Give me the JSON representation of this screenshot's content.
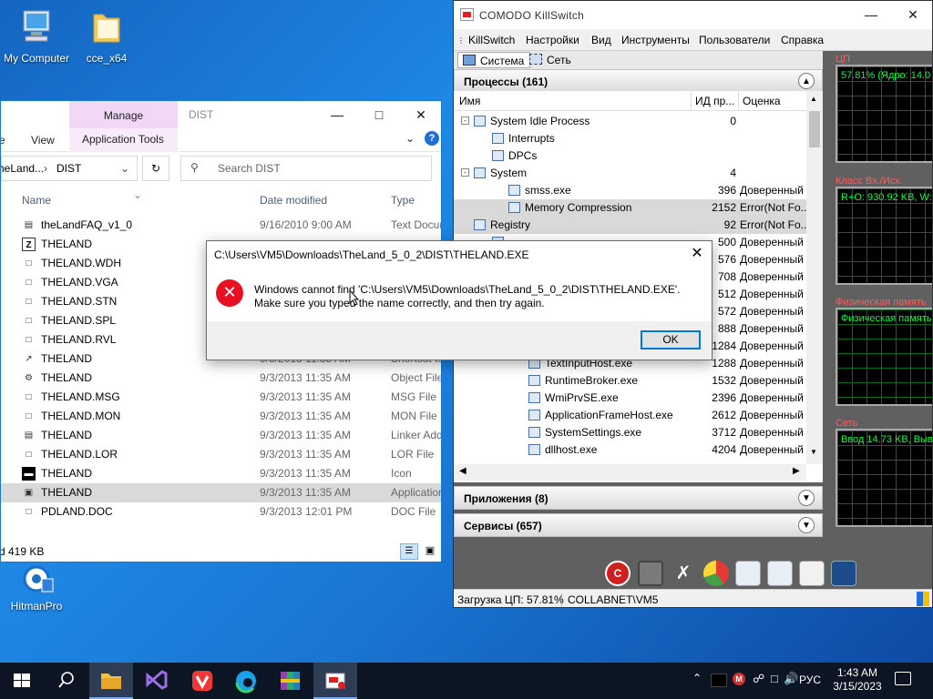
{
  "desktop": {
    "icons": [
      {
        "label": "My Computer"
      },
      {
        "label": "cce_x64"
      },
      {
        "label": "HitmanPro"
      }
    ]
  },
  "explorer": {
    "manage_tab": "Manage",
    "title": "DIST",
    "ribbon": {
      "view": "View",
      "app_tools": "Application Tools",
      "left_item": "e"
    },
    "address": {
      "parent": "heLand...",
      "current": "DIST"
    },
    "search_placeholder": "Search DIST",
    "columns": {
      "name": "Name",
      "date": "Date modified",
      "type": "Type"
    },
    "files": [
      {
        "name": "theLandFAQ_v1_0",
        "date": "9/16/2010 9:00 AM",
        "type": "Text Docum",
        "icon": "text-file-icon"
      },
      {
        "name": "THELAND",
        "date": "",
        "type": "",
        "icon": "z-app-icon"
      },
      {
        "name": "THELAND.WDH",
        "date": "",
        "type": "",
        "icon": "file-icon"
      },
      {
        "name": "THELAND.VGA",
        "date": "",
        "type": "",
        "icon": "file-icon"
      },
      {
        "name": "THELAND.STN",
        "date": "",
        "type": "",
        "icon": "file-icon"
      },
      {
        "name": "THELAND.SPL",
        "date": "",
        "type": "",
        "icon": "file-icon"
      },
      {
        "name": "THELAND.RVL",
        "date": "",
        "type": "",
        "icon": "file-icon"
      },
      {
        "name": "THELAND",
        "date": "9/3/2013 11:35 AM",
        "type": "Shortcut to",
        "icon": "shortcut-icon"
      },
      {
        "name": "THELAND",
        "date": "9/3/2013 11:35 AM",
        "type": "Object File",
        "icon": "object-file-icon"
      },
      {
        "name": "THELAND.MSG",
        "date": "9/3/2013 11:35 AM",
        "type": "MSG File",
        "icon": "file-icon"
      },
      {
        "name": "THELAND.MON",
        "date": "9/3/2013 11:35 AM",
        "type": "MON File",
        "icon": "file-icon"
      },
      {
        "name": "THELAND",
        "date": "9/3/2013 11:35 AM",
        "type": "Linker Addr",
        "icon": "linker-file-icon"
      },
      {
        "name": "THELAND.LOR",
        "date": "9/3/2013 11:35 AM",
        "type": "LOR File",
        "icon": "file-icon"
      },
      {
        "name": "THELAND",
        "date": "9/3/2013 11:35 AM",
        "type": "Icon",
        "icon": "icon-file-icon"
      },
      {
        "name": "THELAND",
        "date": "9/3/2013 11:35 AM",
        "type": "Application",
        "icon": "application-icon"
      },
      {
        "name": "PDLAND.DOC",
        "date": "9/3/2013 12:01 PM",
        "type": "DOC File",
        "icon": "file-icon"
      }
    ],
    "status": "d  419 KB"
  },
  "killswitch": {
    "title": "COMODO KillSwitch",
    "menu": [
      "KillSwitch",
      "Настройки",
      "Вид",
      "Инструменты",
      "Пользователи",
      "Справка"
    ],
    "tabs": [
      "Система",
      "Сеть"
    ],
    "processes_header": "Процессы (161)",
    "columns": {
      "name": "Имя",
      "pid": "ИД пр...",
      "rating": "Оценка"
    },
    "processes": [
      {
        "name": "System Idle Process",
        "pid": "0",
        "rating": ""
      },
      {
        "name": "Interrupts",
        "pid": "",
        "rating": ""
      },
      {
        "name": "DPCs",
        "pid": "",
        "rating": ""
      },
      {
        "name": "System",
        "pid": "4",
        "rating": ""
      },
      {
        "name": "smss.exe",
        "pid": "396",
        "rating": "Доверенный"
      },
      {
        "name": "Memory Compression",
        "pid": "2152",
        "rating": "Error(Not Fo..."
      },
      {
        "name": "Registry",
        "pid": "92",
        "rating": "Error(Not Fo..."
      },
      {
        "name": "",
        "pid": "500",
        "rating": "Доверенный"
      },
      {
        "name": "",
        "pid": "576",
        "rating": "Доверенный"
      },
      {
        "name": "",
        "pid": "708",
        "rating": "Доверенный"
      },
      {
        "name": "",
        "pid": "512",
        "rating": "Доверенный"
      },
      {
        "name": "",
        "pid": "572",
        "rating": "Доверенный"
      },
      {
        "name": "",
        "pid": "888",
        "rating": "Доверенный"
      },
      {
        "name": "",
        "pid": "1284",
        "rating": "Доверенный"
      },
      {
        "name": "TextInputHost.exe",
        "pid": "1288",
        "rating": "Доверенный"
      },
      {
        "name": "RuntimeBroker.exe",
        "pid": "1532",
        "rating": "Доверенный"
      },
      {
        "name": "WmiPrvSE.exe",
        "pid": "2396",
        "rating": "Доверенный"
      },
      {
        "name": "ApplicationFrameHost.exe",
        "pid": "2612",
        "rating": "Доверенный"
      },
      {
        "name": "SystemSettings.exe",
        "pid": "3712",
        "rating": "Доверенный"
      },
      {
        "name": "dllhost.exe",
        "pid": "4204",
        "rating": "Доверенный"
      }
    ],
    "apps_header": "Приложения (8)",
    "services_header": "Сервисы (657)",
    "graphs": [
      {
        "label": "ЦП",
        "text": "57.81% (Ядро: 14.0"
      },
      {
        "label": "Класс Вх./Исх.",
        "text": "R+O: 930.92 KB, W:"
      },
      {
        "label": "Физическая память",
        "text": "Физическая память:"
      },
      {
        "label": "Сеть",
        "text": "Ввод 14.73 KB, Выв"
      }
    ],
    "status": {
      "cpu": "Загрузка ЦП: 57.81%",
      "user": "COLLABNET\\VM5"
    }
  },
  "dialog": {
    "title": "C:\\Users\\VM5\\Downloads\\TheLand_5_0_2\\DIST\\THELAND.EXE",
    "message": "Windows cannot find 'C:\\Users\\VM5\\Downloads\\TheLand_5_0_2\\DIST\\THELAND.EXE'. Make sure you typed the name correctly, and then try again.",
    "ok": "OK"
  },
  "taskbar": {
    "lang": "РУС",
    "time": "1:43 AM",
    "date": "3/15/2023"
  }
}
